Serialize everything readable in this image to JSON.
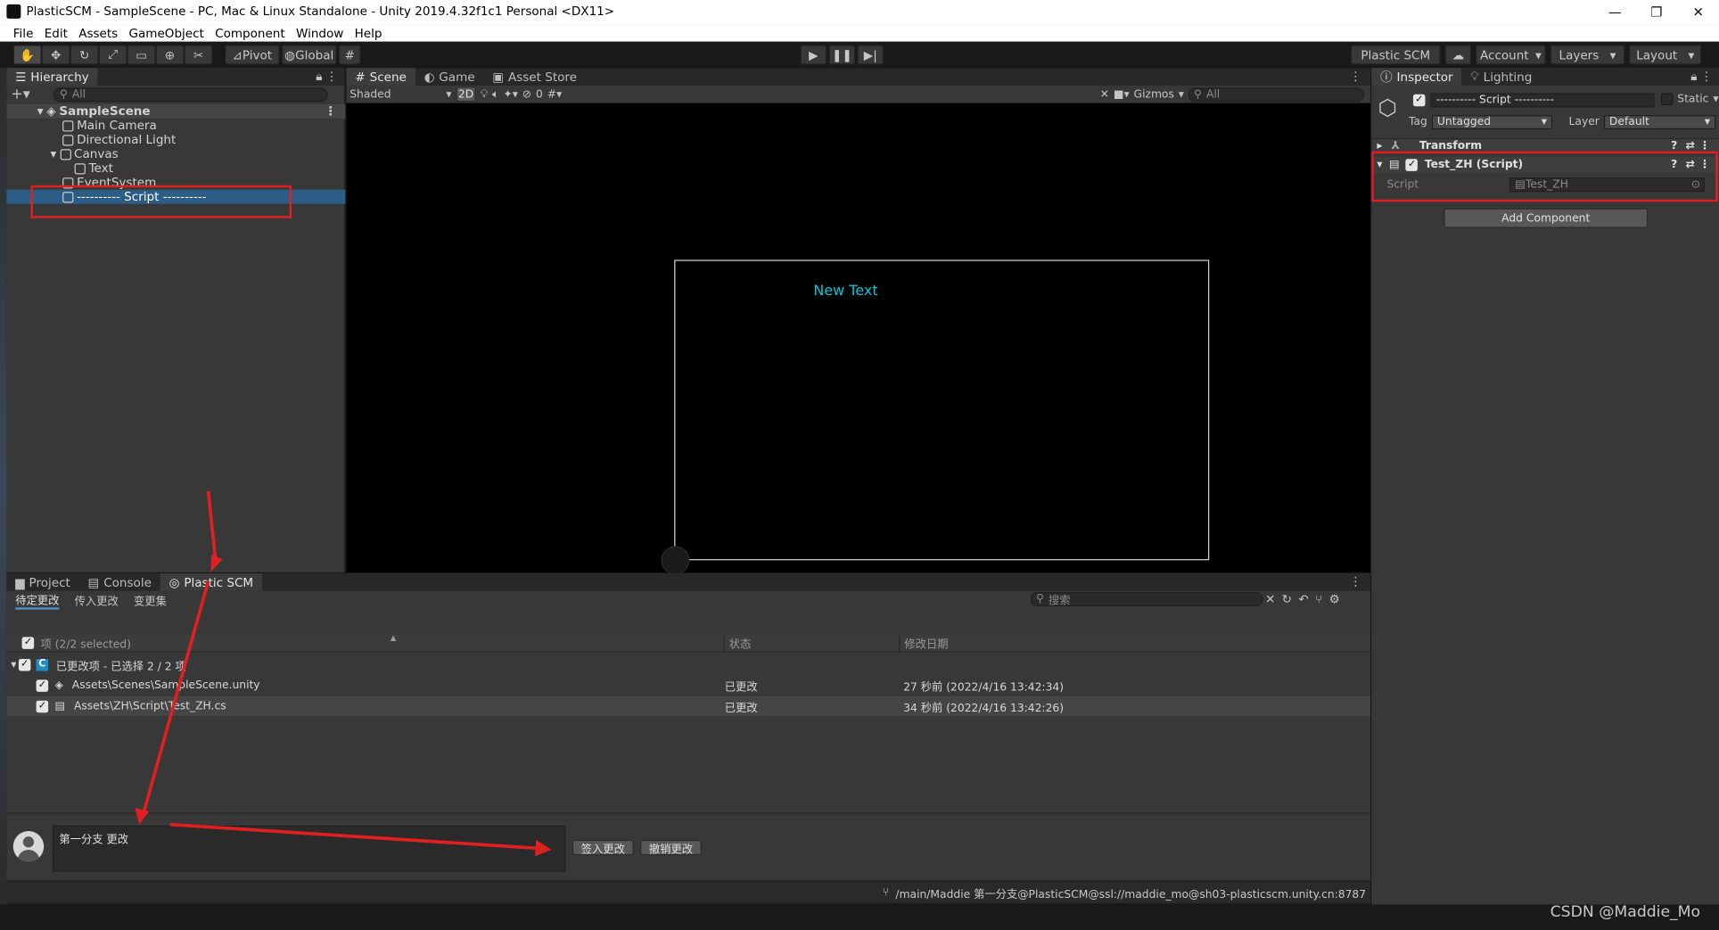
{
  "window": {
    "title": "PlasticSCM - SampleScene - PC, Mac & Linux Standalone - Unity 2019.4.32f1c1 Personal <DX11>",
    "controls": [
      "—",
      "❐",
      "✕"
    ]
  },
  "menu": [
    "File",
    "Edit",
    "Assets",
    "GameObject",
    "Component",
    "Window",
    "Help"
  ],
  "toolbar": {
    "pivot": "Pivot",
    "global": "Global",
    "plastic_scm": "Plastic SCM",
    "account": "Account",
    "layers": "Layers",
    "layout": "Layout"
  },
  "hierarchy": {
    "tab": "Hierarchy",
    "search_placeholder": "All",
    "scene": "SampleScene",
    "items": [
      {
        "label": "Main Camera"
      },
      {
        "label": "Directional Light"
      },
      {
        "label": "Canvas"
      },
      {
        "label": "Text"
      },
      {
        "label": "EventSystem"
      },
      {
        "label": "---------- Script ----------"
      }
    ]
  },
  "scene": {
    "tabs": [
      "Scene",
      "Game",
      "Asset Store"
    ],
    "shading": "Shaded",
    "mode_2d": "2D",
    "hidden_count": "0",
    "gizmos": "Gizmos",
    "search_placeholder": "All",
    "canvas_text": "New Text"
  },
  "inspector": {
    "tabs": [
      "Inspector",
      "Lighting"
    ],
    "object_name": "---------- Script ----------",
    "static_label": "Static",
    "tag_label": "Tag",
    "tag_value": "Untagged",
    "layer_label": "Layer",
    "layer_value": "Default",
    "components": [
      {
        "name": "Transform"
      },
      {
        "name": "Test_ZH (Script)"
      }
    ],
    "script_label": "Script",
    "script_value": "Test_ZH",
    "add_component": "Add Component"
  },
  "bottom": {
    "tabs": [
      "Project",
      "Console",
      "Plastic SCM"
    ],
    "subtabs": [
      "待定更改",
      "传入更改",
      "变更集"
    ],
    "search_placeholder": "搜索",
    "columns": [
      "项 (2/2 selected)",
      "状态",
      "修改日期"
    ],
    "group": {
      "badge": "C",
      "label": "已更改项 - 已选择 2 / 2 项"
    },
    "rows": [
      {
        "path": "Assets\\Scenes\\SampleScene.unity",
        "status": "已更改",
        "date": "27 秒前 (2022/4/16 13:42:34)"
      },
      {
        "path": "Assets\\ZH\\Script\\Test_ZH.cs",
        "status": "已更改",
        "date": "34 秒前 (2022/4/16 13:42:26)"
      }
    ],
    "comment": "第一分支 更改",
    "checkin": "签入更改",
    "undo": "撤销更改"
  },
  "status": {
    "workspace": "/main/Maddie 第一分支@PlasticSCM@ssl://maddie_mo@sh03-plasticscm.unity.cn:8787"
  },
  "watermark": "CSDN @Maddie_Mo",
  "colors": {
    "highlight": "#2c5d87",
    "annotation": "#e02020",
    "text_cyan": "#00c8d8"
  }
}
